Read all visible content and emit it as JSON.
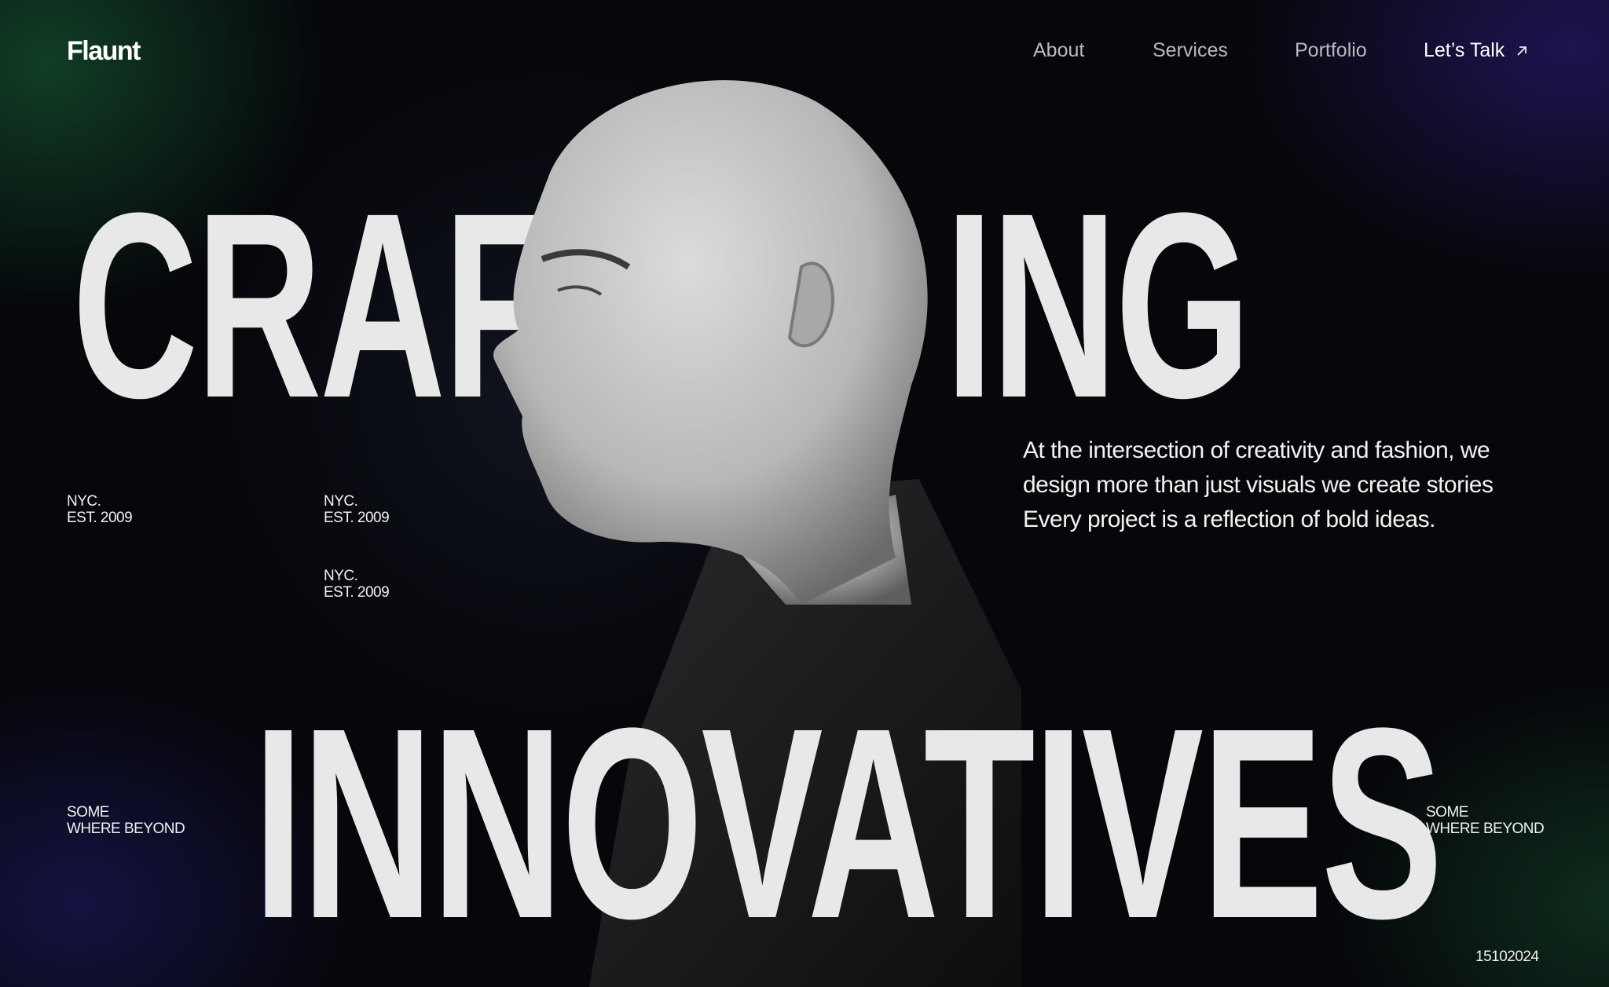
{
  "brand": "Flaunt",
  "nav": {
    "items": [
      "About",
      "Services",
      "Portfolio"
    ],
    "cta": "Let’s Talk",
    "cta_icon": "arrow-up-right-icon"
  },
  "hero": {
    "line1_left": "CRAF",
    "line1_right": "ING",
    "line2": "INNOVATIVES"
  },
  "labels": {
    "nyc1": [
      "NYC.",
      "EST. 2009"
    ],
    "nyc2": [
      "NYC.",
      "EST. 2009"
    ],
    "nyc3": [
      "NYC.",
      "EST. 2009"
    ],
    "left_bottom": [
      "SOME",
      "WHERE BEYOND"
    ],
    "right_bottom": [
      "SOME",
      "WHERE BEYOND"
    ]
  },
  "description": [
    "At the intersection of creativity and fashion, we",
    "design more than just visuals we create stories",
    "Every project is a reflection of bold ideas."
  ],
  "date_code": "15102024"
}
